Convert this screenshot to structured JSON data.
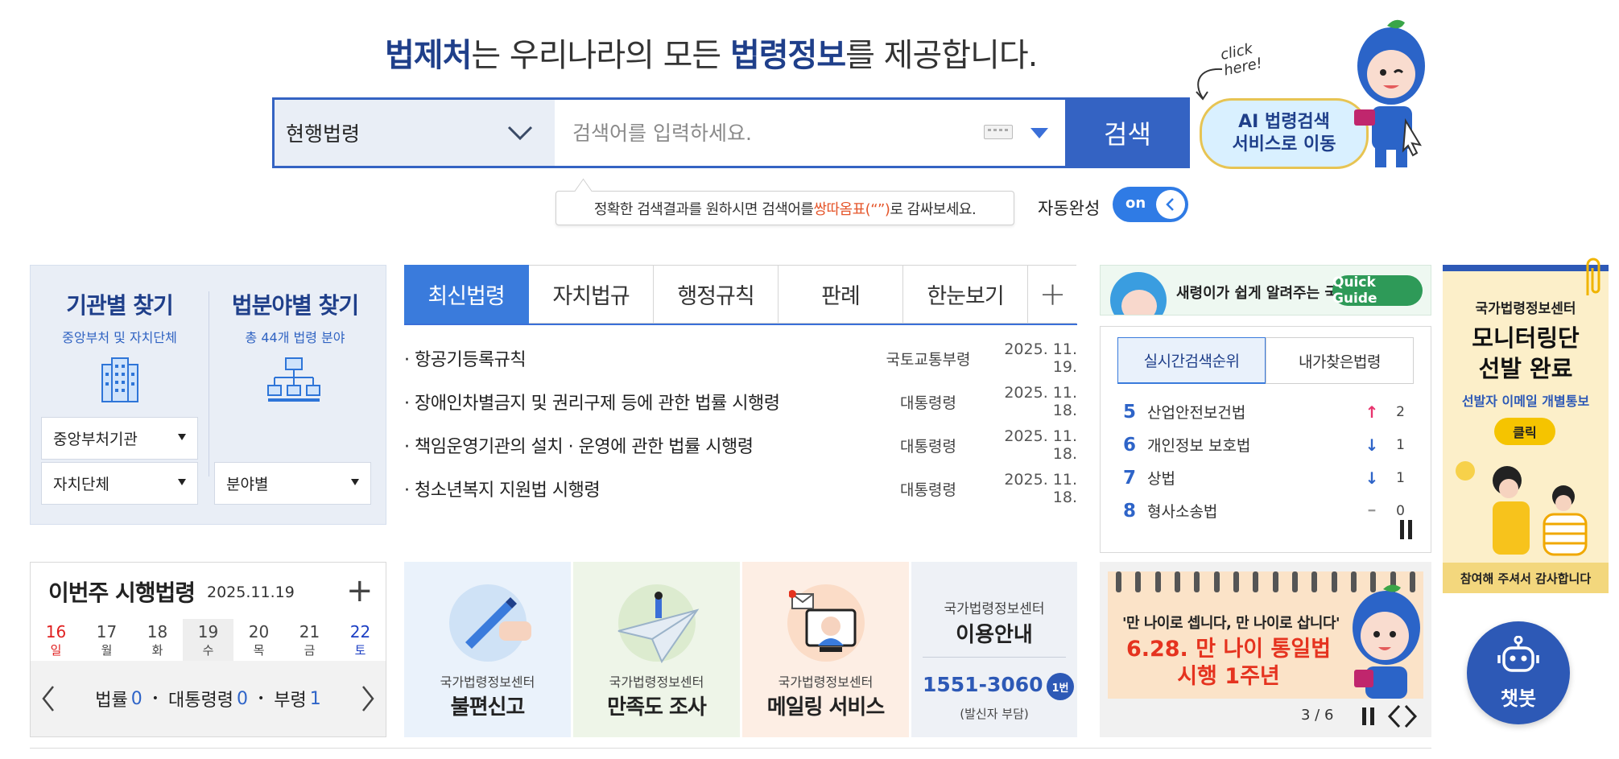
{
  "header": {
    "headline_part1": "법제처",
    "headline_part2": "는 우리나라의 모든 ",
    "headline_part3": "법령정보",
    "headline_part4": "를 제공합니다."
  },
  "search": {
    "scope_value": "현행법령",
    "placeholder": "검색어를 입력하세요.",
    "button_label": "검색",
    "tip_before": "정확한 검색결과를 원하시면 검색어를 ",
    "tip_highlight": "쌍따옴표(“”)",
    "tip_after": "로  감싸보세요.",
    "autocomplete_label": "자동완성",
    "autocomplete_state": "on"
  },
  "ai_promo": {
    "click_line1": "click",
    "click_line2": "here!",
    "line1": "AI 법령검색",
    "line2": "서비스로 이동"
  },
  "find": {
    "org_title": "기관별 찾기",
    "org_sub": "중앙부처 및 자치단체",
    "field_title": "법분야별 찾기",
    "field_sub": "총 44개 법령 분야",
    "select_central": "중앙부처기관",
    "select_local": "자치단체",
    "select_field": "분야별"
  },
  "tabs": [
    {
      "label": "최신법령"
    },
    {
      "label": "자치법규"
    },
    {
      "label": "행정규칙"
    },
    {
      "label": "판례"
    },
    {
      "label": "한눈보기"
    },
    {
      "label": "+"
    }
  ],
  "latest_laws": [
    {
      "title": "· 항공기등록규칙",
      "org": "국토교통부령",
      "date": "2025. 11. 19."
    },
    {
      "title": "· 장애인차별금지 및 권리구제 등에 관한 법률 시행령",
      "org": "대통령령",
      "date": "2025. 11. 18."
    },
    {
      "title": "· 책임운영기관의 설치 · 운영에 관한 법률 시행령",
      "org": "대통령령",
      "date": "2025. 11. 18."
    },
    {
      "title": "· 청소년복지 지원법 시행령",
      "org": "대통령령",
      "date": "2025. 11. 18."
    }
  ],
  "quick_guide": {
    "text": "새령이가 쉽게 알려주는 국법",
    "button": "Quick Guide"
  },
  "ranking": {
    "tab_realtime": "실시간검색순위",
    "tab_mine": "내가찾은법령",
    "items": [
      {
        "rank": "5",
        "name": "산업안전보건법",
        "trend": "↑",
        "change": "2",
        "color": "#e8336d"
      },
      {
        "rank": "6",
        "name": "개인정보 보호법",
        "trend": "↓",
        "change": "1",
        "color": "#2e64c8"
      },
      {
        "rank": "7",
        "name": "상법",
        "trend": "↓",
        "change": "1",
        "color": "#2e64c8"
      },
      {
        "rank": "8",
        "name": "형사소송법",
        "trend": "━",
        "change": "0",
        "color": "#999999"
      }
    ]
  },
  "side_banner": {
    "line1": "국가법령정보센터",
    "line2a": "모니터링단",
    "line2b": "선발 완료",
    "line3": "선발자 이메일 개별통보",
    "button": "클릭",
    "footer": "참여해 주셔서 감사합니다"
  },
  "chatbot": {
    "label": "챗봇"
  },
  "this_week": {
    "title": "이번주 시행법령",
    "date": "2025.11.19",
    "plus": "+",
    "days": [
      {
        "d": "16",
        "w": "일"
      },
      {
        "d": "17",
        "w": "월"
      },
      {
        "d": "18",
        "w": "화"
      },
      {
        "d": "19",
        "w": "수"
      },
      {
        "d": "20",
        "w": "목"
      },
      {
        "d": "21",
        "w": "금"
      },
      {
        "d": "22",
        "w": "토"
      }
    ],
    "law_label": "법률",
    "law_count": "0",
    "decree_label": "대통령령",
    "decree_count": "0",
    "ordinance_label": "부령",
    "ordinance_count": "1"
  },
  "services": {
    "complaint_small": "국가법령정보센터",
    "complaint_big": "불편신고",
    "survey_small": "국가법령정보센터",
    "survey_big": "만족도 조사",
    "mail_small": "국가법령정보센터",
    "mail_big": "메일링 서비스",
    "info_small": "국가법령정보센터",
    "info_big": "이용안내",
    "phone": "1551-3060",
    "phone_badge": "1번",
    "phone_note": "(발신자 부담)"
  },
  "age_banner": {
    "line1": "'만 나이로 셉니다, 만 나이로 삽니다'",
    "line2a": "6.28. 만 나이 통일법",
    "line2b": "시행 1주년",
    "pager": "3 / 6"
  },
  "colors": {
    "brand_navy": "#1f3f8a",
    "brand_blue": "#3463c3",
    "tab_active": "#3a7bdc",
    "highlight_orange": "#e5562b"
  }
}
